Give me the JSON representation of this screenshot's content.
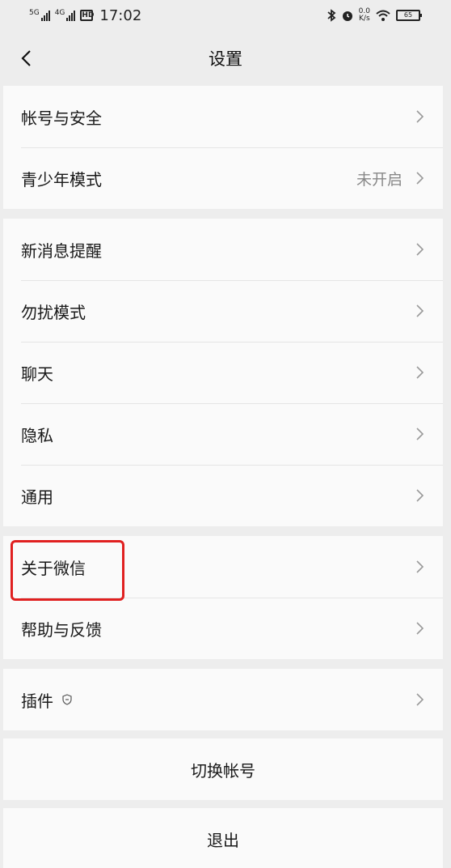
{
  "status_bar": {
    "sig1_tag": "5G",
    "sig2_tag": "4G",
    "sim_label": "HD",
    "time": "17:02",
    "net_speed_top": "0.0",
    "net_speed_bottom": "K/s",
    "battery": "65"
  },
  "nav": {
    "title": "设置"
  },
  "groups": [
    {
      "items": [
        {
          "label": "帐号与安全",
          "value": ""
        },
        {
          "label": "青少年模式",
          "value": "未开启"
        }
      ]
    },
    {
      "items": [
        {
          "label": "新消息提醒"
        },
        {
          "label": "勿扰模式"
        },
        {
          "label": "聊天"
        },
        {
          "label": "隐私"
        },
        {
          "label": "通用"
        }
      ]
    },
    {
      "items": [
        {
          "label": "关于微信"
        },
        {
          "label": "帮助与反馈"
        }
      ]
    },
    {
      "items": [
        {
          "label": "插件",
          "icon": "shield-icon"
        }
      ]
    }
  ],
  "buttons": {
    "switch_account": "切换帐号",
    "logout": "退出"
  },
  "colors": {
    "background": "#ededed",
    "row_background": "#fafafa",
    "highlight": "#e02020"
  }
}
